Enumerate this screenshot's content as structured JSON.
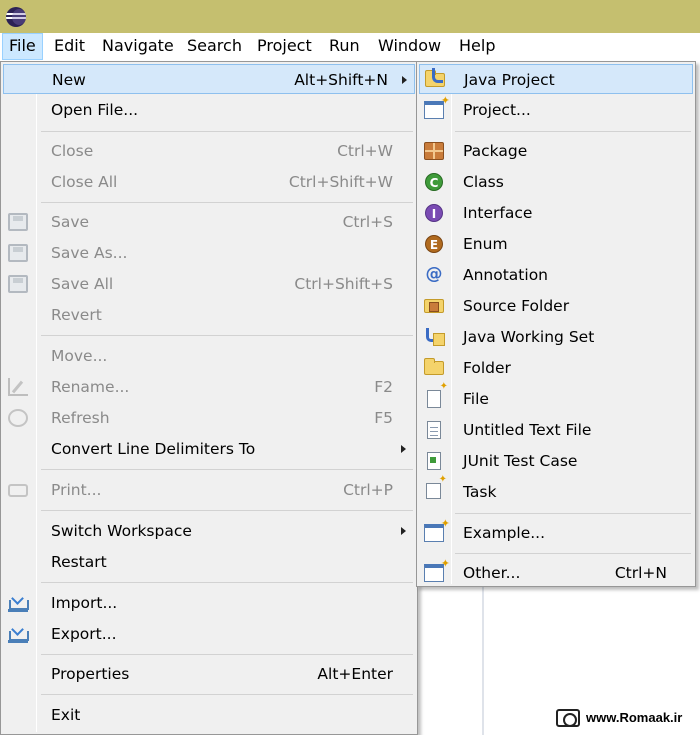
{
  "menubar": {
    "items": [
      "File",
      "Edit",
      "Navigate",
      "Search",
      "Project",
      "Run",
      "Window",
      "Help"
    ]
  },
  "file_menu": {
    "new": {
      "label": "New",
      "shortcut": "Alt+Shift+N"
    },
    "open_file": {
      "label": "Open File..."
    },
    "close": {
      "label": "Close",
      "shortcut": "Ctrl+W"
    },
    "close_all": {
      "label": "Close All",
      "shortcut": "Ctrl+Shift+W"
    },
    "save": {
      "label": "Save",
      "shortcut": "Ctrl+S"
    },
    "save_as": {
      "label": "Save As..."
    },
    "save_all": {
      "label": "Save All",
      "shortcut": "Ctrl+Shift+S"
    },
    "revert": {
      "label": "Revert"
    },
    "move": {
      "label": "Move..."
    },
    "rename": {
      "label": "Rename...",
      "shortcut": "F2"
    },
    "refresh": {
      "label": "Refresh",
      "shortcut": "F5"
    },
    "convert": {
      "label": "Convert Line Delimiters To"
    },
    "print": {
      "label": "Print...",
      "shortcut": "Ctrl+P"
    },
    "switch_workspace": {
      "label": "Switch Workspace"
    },
    "restart": {
      "label": "Restart"
    },
    "import": {
      "label": "Import..."
    },
    "export": {
      "label": "Export..."
    },
    "properties": {
      "label": "Properties",
      "shortcut": "Alt+Enter"
    },
    "exit": {
      "label": "Exit"
    }
  },
  "new_menu": {
    "java_project": {
      "label": "Java Project"
    },
    "project": {
      "label": "Project..."
    },
    "package": {
      "label": "Package"
    },
    "class": {
      "label": "Class"
    },
    "interface": {
      "label": "Interface"
    },
    "enum": {
      "label": "Enum"
    },
    "annotation": {
      "label": "Annotation"
    },
    "source_folder": {
      "label": "Source Folder"
    },
    "java_working_set": {
      "label": "Java Working Set"
    },
    "folder": {
      "label": "Folder"
    },
    "file": {
      "label": "File"
    },
    "untitled_text_file": {
      "label": "Untitled Text File"
    },
    "junit_test_case": {
      "label": "JUnit Test Case"
    },
    "task": {
      "label": "Task"
    },
    "example": {
      "label": "Example..."
    },
    "other": {
      "label": "Other...",
      "shortcut": "Ctrl+N"
    }
  },
  "icons": {
    "class_glyph": "C",
    "interface_glyph": "I",
    "enum_glyph": "E",
    "annotation_glyph": "@"
  },
  "watermark": {
    "text": "www.Romaak.ir"
  },
  "colors": {
    "titlebar": "#c5bf6f",
    "menu_bg": "#f0f0f0",
    "highlight": "#d5e8fa",
    "active_menubar": "#cce8ff"
  }
}
